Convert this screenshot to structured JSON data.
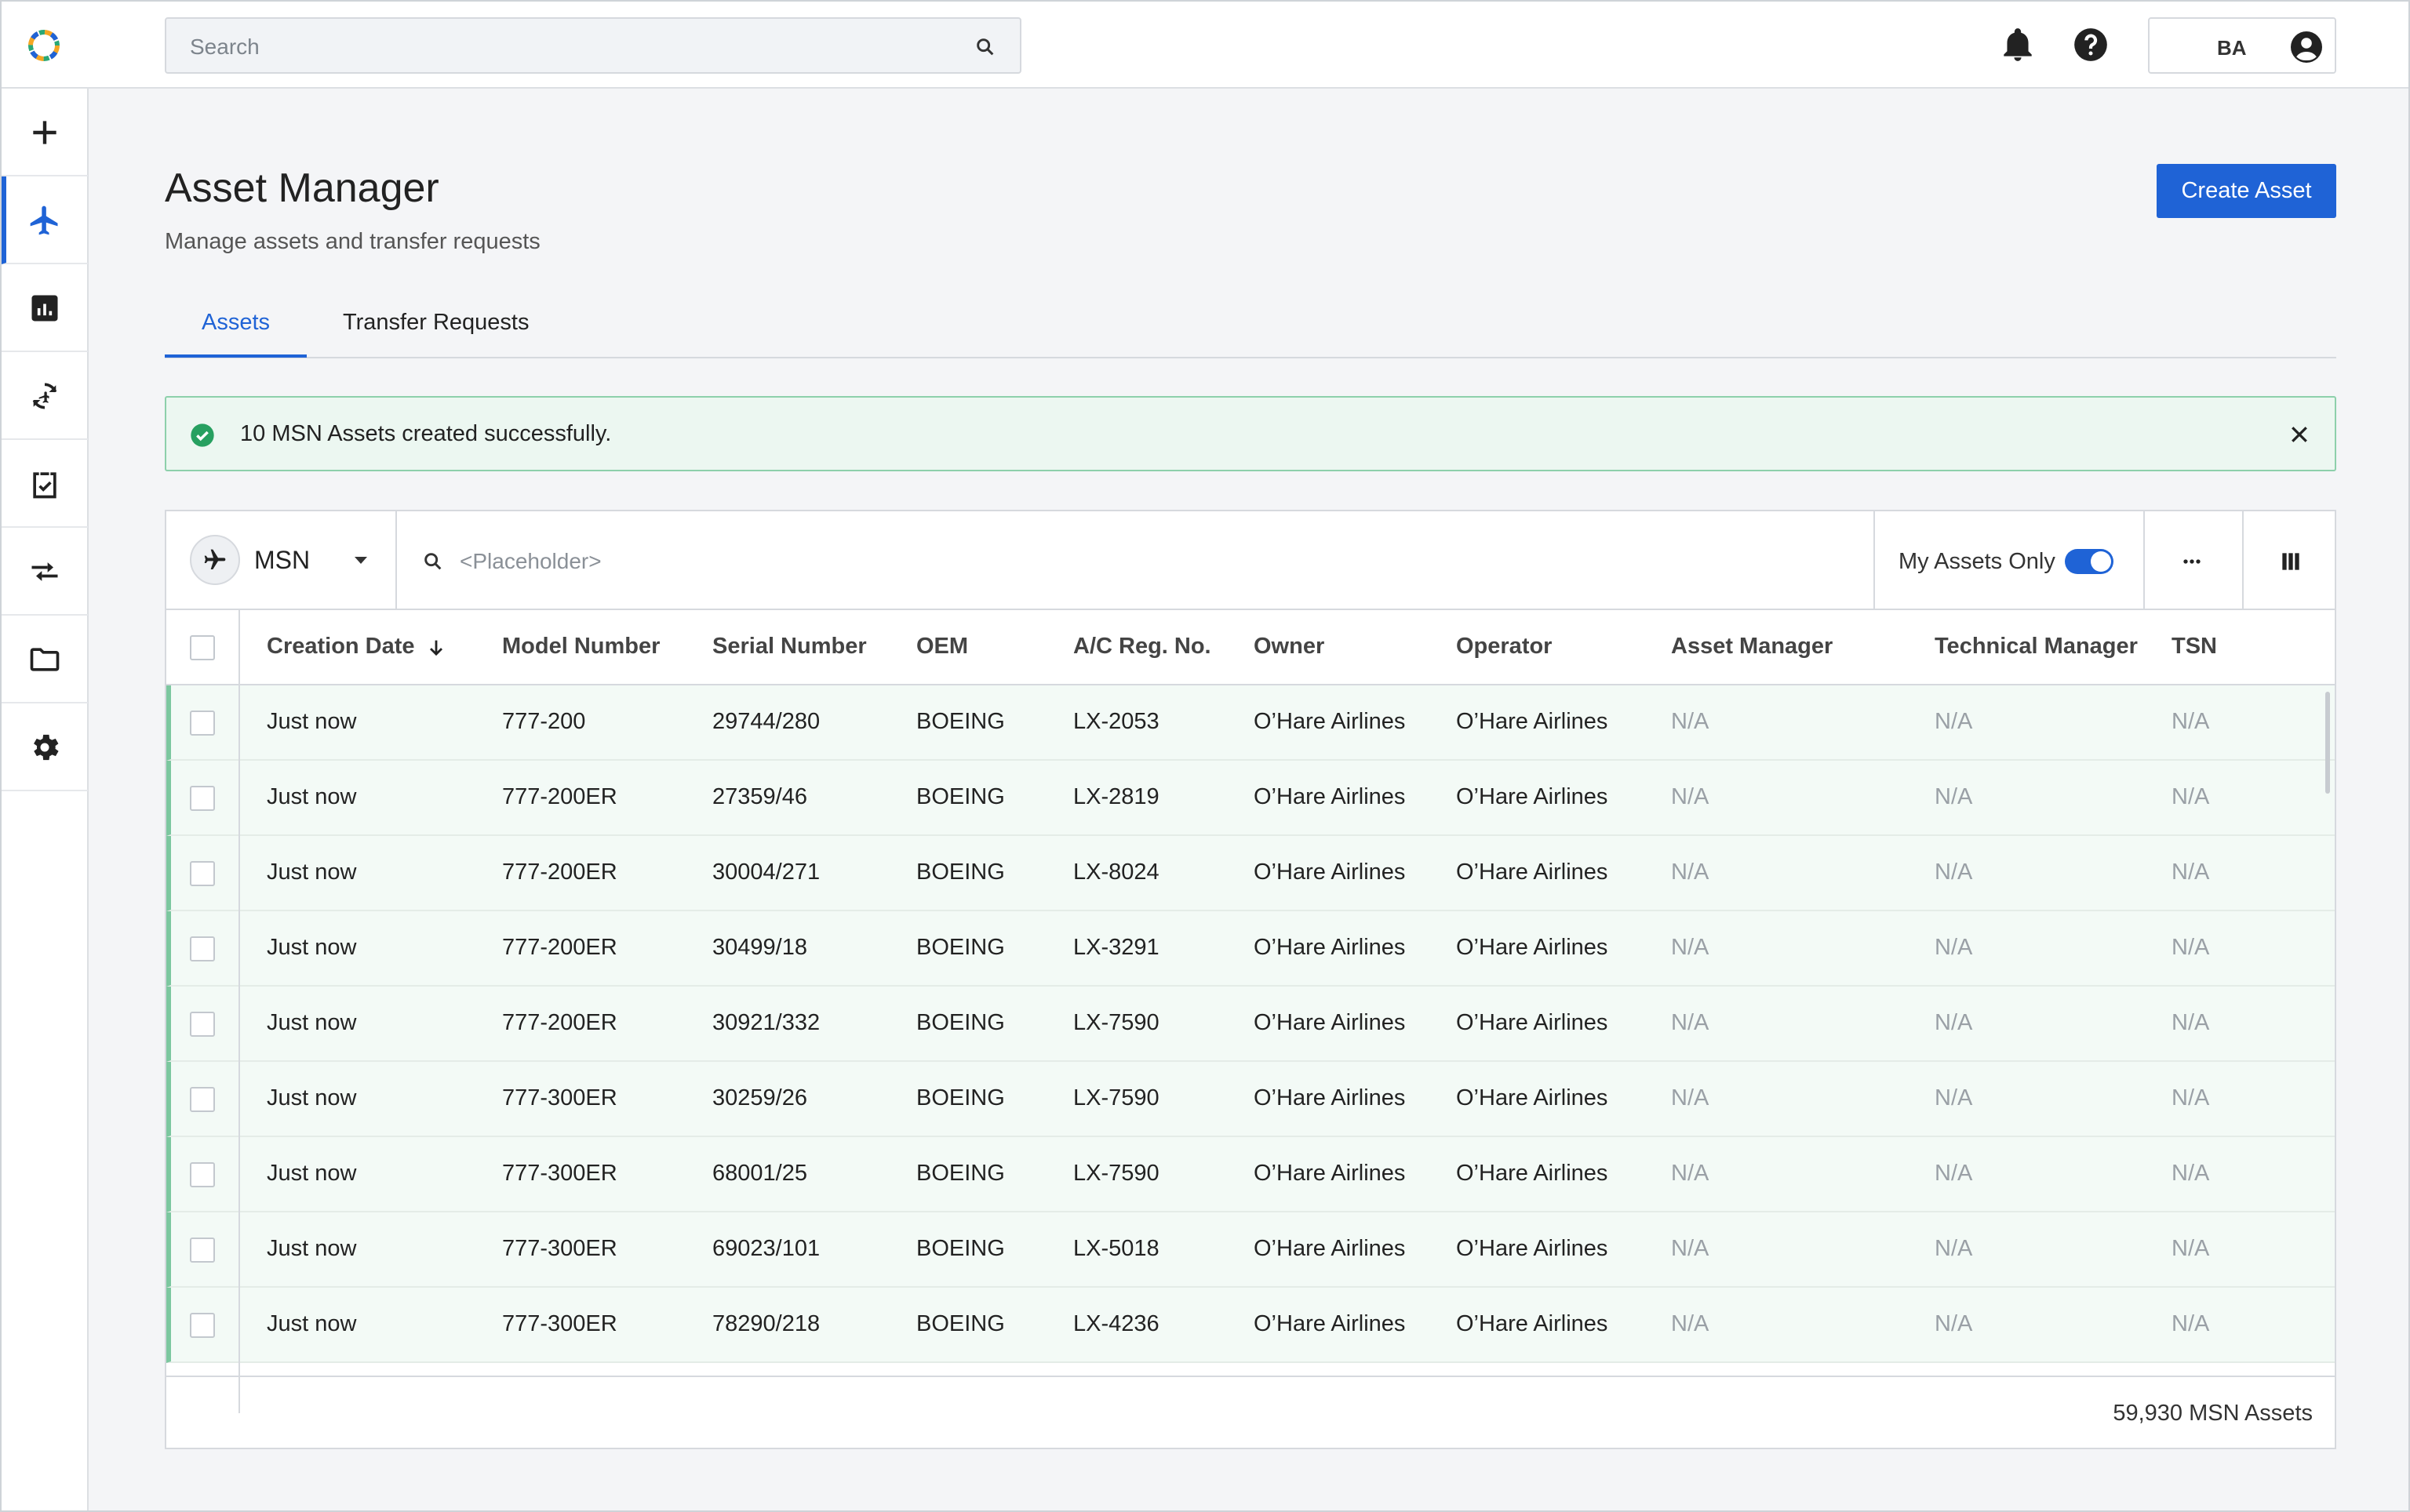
{
  "header": {
    "search_placeholder": "Search",
    "user_initials": "BA"
  },
  "sidebar": {
    "items": [
      {
        "icon": "plus-icon",
        "label": "Create"
      },
      {
        "icon": "airplane-icon",
        "label": "Assets",
        "active": true
      },
      {
        "icon": "chart-icon",
        "label": "Reports"
      },
      {
        "icon": "sync-icon",
        "label": "Sync"
      },
      {
        "icon": "clipboard-check-icon",
        "label": "Tasks"
      },
      {
        "icon": "transfer-icon",
        "label": "Transfers"
      },
      {
        "icon": "folder-icon",
        "label": "Files"
      },
      {
        "icon": "gear-icon",
        "label": "Settings"
      }
    ]
  },
  "page": {
    "title": "Asset Manager",
    "subtitle": "Manage assets and transfer requests",
    "create_button": "Create Asset"
  },
  "tabs": [
    {
      "label": "Assets",
      "active": true
    },
    {
      "label": "Transfer Requests",
      "active": false
    }
  ],
  "alert": {
    "message": "10 MSN Assets created successfully."
  },
  "toolbar": {
    "asset_type": "MSN",
    "search_placeholder": "<Placeholder>",
    "my_assets_label": "My Assets Only",
    "my_assets_on": true
  },
  "table": {
    "columns": [
      "Creation Date",
      "Model Number",
      "Serial Number",
      "OEM",
      "A/C Reg. No.",
      "Owner",
      "Operator",
      "Asset Manager",
      "Technical Manager",
      "TSN"
    ],
    "rows": [
      [
        "Just now",
        "777-200",
        "29744/280",
        "BOEING",
        "LX-2053",
        "O’Hare Airlines",
        "O’Hare Airlines",
        "N/A",
        "N/A",
        "N/A"
      ],
      [
        "Just now",
        "777-200ER",
        "27359/46",
        "BOEING",
        "LX-2819",
        "O’Hare Airlines",
        "O’Hare Airlines",
        "N/A",
        "N/A",
        "N/A"
      ],
      [
        "Just now",
        "777-200ER",
        "30004/271",
        "BOEING",
        "LX-8024",
        "O’Hare Airlines",
        "O’Hare Airlines",
        "N/A",
        "N/A",
        "N/A"
      ],
      [
        "Just now",
        "777-200ER",
        "30499/18",
        "BOEING",
        "LX-3291",
        "O’Hare Airlines",
        "O’Hare Airlines",
        "N/A",
        "N/A",
        "N/A"
      ],
      [
        "Just now",
        "777-200ER",
        "30921/332",
        "BOEING",
        "LX-7590",
        "O’Hare Airlines",
        "O’Hare Airlines",
        "N/A",
        "N/A",
        "N/A"
      ],
      [
        "Just now",
        "777-300ER",
        "30259/26",
        "BOEING",
        "LX-7590",
        "O’Hare Airlines",
        "O’Hare Airlines",
        "N/A",
        "N/A",
        "N/A"
      ],
      [
        "Just now",
        "777-300ER",
        "68001/25",
        "BOEING",
        "LX-7590",
        "O’Hare Airlines",
        "O’Hare Airlines",
        "N/A",
        "N/A",
        "N/A"
      ],
      [
        "Just now",
        "777-300ER",
        "69023/101",
        "BOEING",
        "LX-5018",
        "O’Hare Airlines",
        "O’Hare Airlines",
        "N/A",
        "N/A",
        "N/A"
      ],
      [
        "Just now",
        "777-300ER",
        "78290/218",
        "BOEING",
        "LX-4236",
        "O’Hare Airlines",
        "O’Hare Airlines",
        "N/A",
        "N/A",
        "N/A"
      ]
    ],
    "footer_count": "59,930 MSN Assets"
  },
  "colors": {
    "accent": "#1f63d6",
    "success_bg": "#ecf7f1",
    "success_border": "#8dd0ab",
    "row_highlight": "#f3faf6"
  }
}
